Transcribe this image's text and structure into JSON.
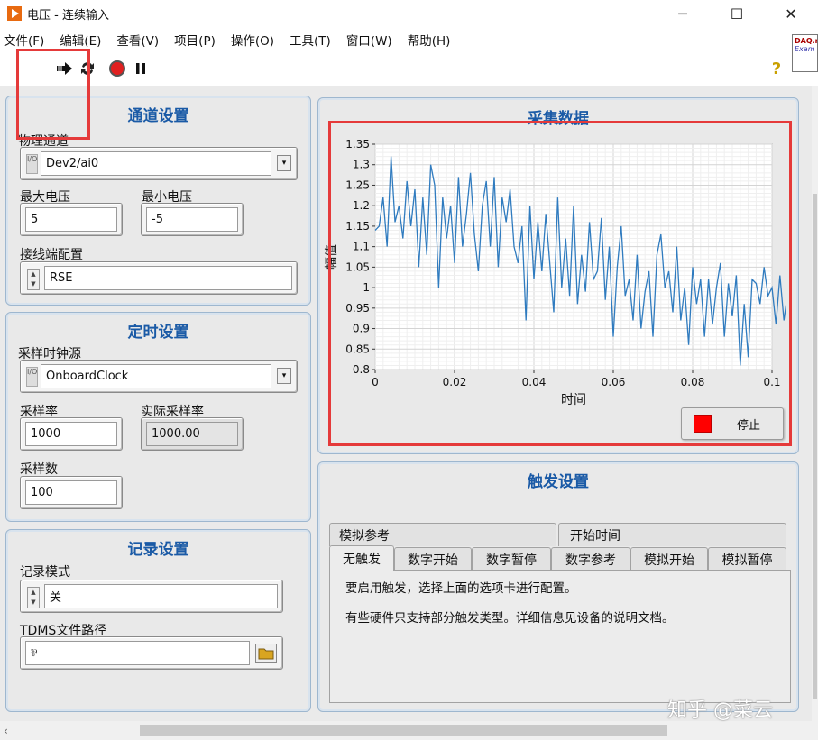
{
  "window": {
    "title": "电压 - 连续输入",
    "minimize": "─",
    "maximize": "☐",
    "close": "✕"
  },
  "menu": [
    "文件(F)",
    "编辑(E)",
    "查看(V)",
    "项目(P)",
    "操作(O)",
    "工具(T)",
    "窗口(W)",
    "帮助(H)"
  ],
  "logo": {
    "line1": "DAQ.m",
    "line2": "Exam"
  },
  "help_glyph": "?",
  "channel_settings": {
    "title": "通道设置",
    "physical_channel_label": "物理通道",
    "physical_channel_value": "Dev2/ai0",
    "max_voltage_label": "最大电压",
    "max_voltage_value": "5",
    "min_voltage_label": "最小电压",
    "min_voltage_value": "-5",
    "terminal_config_label": "接线端配置",
    "terminal_config_value": "RSE"
  },
  "timing_settings": {
    "title": "定时设置",
    "clock_source_label": "采样时钟源",
    "clock_source_value": "OnboardClock",
    "rate_label": "采样率",
    "rate_value": "1000",
    "actual_rate_label": "实际采样率",
    "actual_rate_value": "1000.00",
    "samples_label": "采样数",
    "samples_value": "100"
  },
  "logging_settings": {
    "title": "记录设置",
    "mode_label": "记录模式",
    "mode_value": "关",
    "tdms_label": "TDMS文件路径",
    "tdms_value": ""
  },
  "acquired_data": {
    "title": "采集数据",
    "stop_label": "停止"
  },
  "chart_data": {
    "type": "line",
    "title": "采集数据",
    "xlabel": "时间",
    "ylabel": "幅值",
    "xlim": [
      0,
      0.1
    ],
    "ylim": [
      0.8,
      1.35
    ],
    "x_ticks": [
      "0",
      "0.02",
      "0.04",
      "0.06",
      "0.08",
      "0.1"
    ],
    "y_ticks": [
      "0.8",
      "0.85",
      "0.9",
      "0.95",
      "1",
      "1.05",
      "1.1",
      "1.15",
      "1.2",
      "1.25",
      "1.3",
      "1.35"
    ],
    "grid": true,
    "series": [
      {
        "color": "#2f7bbf",
        "x_start": 0,
        "x_step": 0.001,
        "values": [
          1.14,
          1.15,
          1.22,
          1.1,
          1.32,
          1.16,
          1.2,
          1.12,
          1.26,
          1.15,
          1.24,
          1.05,
          1.22,
          1.08,
          1.3,
          1.25,
          1.0,
          1.22,
          1.12,
          1.2,
          1.06,
          1.27,
          1.1,
          1.18,
          1.28,
          1.13,
          1.04,
          1.2,
          1.26,
          1.1,
          1.27,
          1.05,
          1.22,
          1.16,
          1.24,
          1.1,
          1.06,
          1.15,
          0.92,
          1.2,
          1.02,
          1.16,
          1.04,
          1.18,
          1.06,
          0.94,
          1.22,
          1.0,
          1.12,
          0.98,
          1.2,
          0.96,
          1.08,
          0.99,
          1.16,
          1.02,
          1.04,
          1.17,
          0.97,
          1.1,
          0.88,
          1.05,
          1.15,
          0.98,
          1.02,
          0.92,
          1.08,
          0.9,
          0.99,
          1.04,
          0.88,
          1.08,
          1.13,
          1.0,
          1.04,
          0.94,
          1.1,
          0.92,
          1.0,
          0.86,
          1.05,
          0.96,
          1.02,
          0.88,
          1.02,
          0.91,
          1.0,
          1.06,
          0.88,
          1.01,
          0.93,
          1.03,
          0.81,
          0.96,
          0.83,
          1.02,
          1.01,
          0.96,
          1.05,
          0.98,
          1.0,
          0.91,
          1.03,
          0.92,
          0.99,
          0.96,
          0.98,
          1.0,
          0.94,
          0.84
        ]
      }
    ]
  },
  "trigger_settings": {
    "title": "触发设置",
    "tabs_row1": [
      "模拟参考",
      "开始时间"
    ],
    "tabs_row2": [
      "无触发",
      "数字开始",
      "数字暂停",
      "数字参考",
      "模拟开始",
      "模拟暂停"
    ],
    "active_tab": "无触发",
    "line1": "要启用触发，选择上面的选项卡进行配置。",
    "line2": "有些硬件只支持部分触发类型。详细信息见设备的说明文档。"
  },
  "watermark": "知乎 @菜云"
}
